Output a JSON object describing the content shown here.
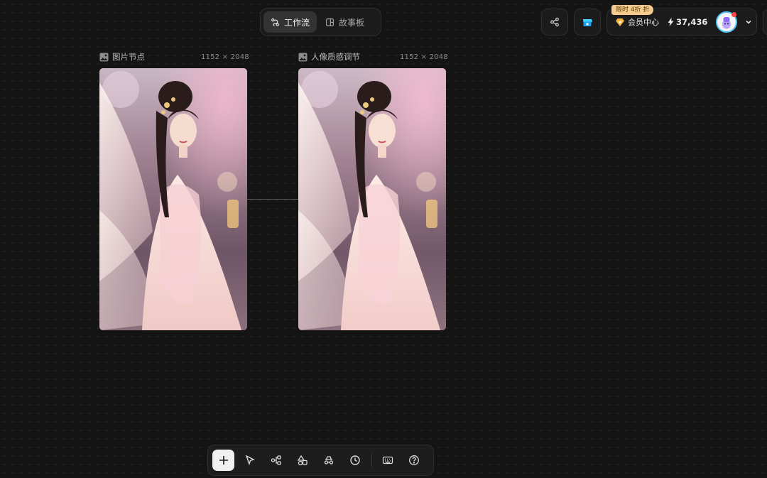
{
  "mode_switch": {
    "tabs": [
      {
        "label": "工作流",
        "icon": "workflow-icon",
        "active": true
      },
      {
        "label": "故事板",
        "icon": "storyboard-icon",
        "active": false
      }
    ]
  },
  "header_right": {
    "share_icon": "share-icon",
    "store_icon": "store-icon",
    "promo_badge": "限时 4折 折",
    "member_center": "会员中心",
    "points": "37,436",
    "avatar_icon": "avatar",
    "accent": "#4fc3f7",
    "badge_color": "#f6cc8e"
  },
  "nodes": [
    {
      "title": "图片节点",
      "dims": "1152 × 2048",
      "icon": "image-icon"
    },
    {
      "title": "人像质感调节",
      "dims": "1152 × 2048",
      "icon": "image-icon"
    }
  ],
  "toolbar": {
    "tools": [
      {
        "icon": "plus-icon",
        "active": true
      },
      {
        "icon": "cursor-icon",
        "active": false
      },
      {
        "icon": "node-graph-icon",
        "active": false
      },
      {
        "icon": "shapes-icon",
        "active": false
      },
      {
        "icon": "incognito-icon",
        "active": false
      },
      {
        "icon": "history-icon",
        "active": false
      },
      {
        "icon": "keyboard-icon",
        "active": false
      },
      {
        "icon": "help-icon",
        "active": false
      }
    ]
  }
}
